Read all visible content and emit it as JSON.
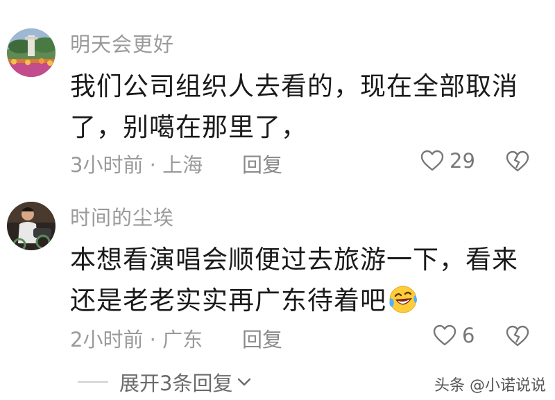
{
  "comments": [
    {
      "username": "明天会更好",
      "content": "我们公司组织人去看的，现在全部取消了，别噶在那里了，",
      "meta": "3小时前 · 上海",
      "reply_label": "回复",
      "likes": "29",
      "avatar_icon": "avatar-flower-garden-icon"
    },
    {
      "username": "时间的尘埃",
      "content": "本想看演唱会顺便过去旅游一下，看来还是老老实实再广东待着吧",
      "meta": "2小时前 · 广东",
      "reply_label": "回复",
      "likes": "6",
      "avatar_icon": "avatar-man-motorbike-icon",
      "emoji_icon": "laughing-crying-emoji-icon"
    }
  ],
  "expand_replies": {
    "label": "展开3条回复"
  },
  "watermark": "头条 @小诺说说",
  "colors": {
    "text_primary": "#1a1a1a",
    "text_secondary": "#9a9a9a",
    "background": "#ffffff"
  }
}
